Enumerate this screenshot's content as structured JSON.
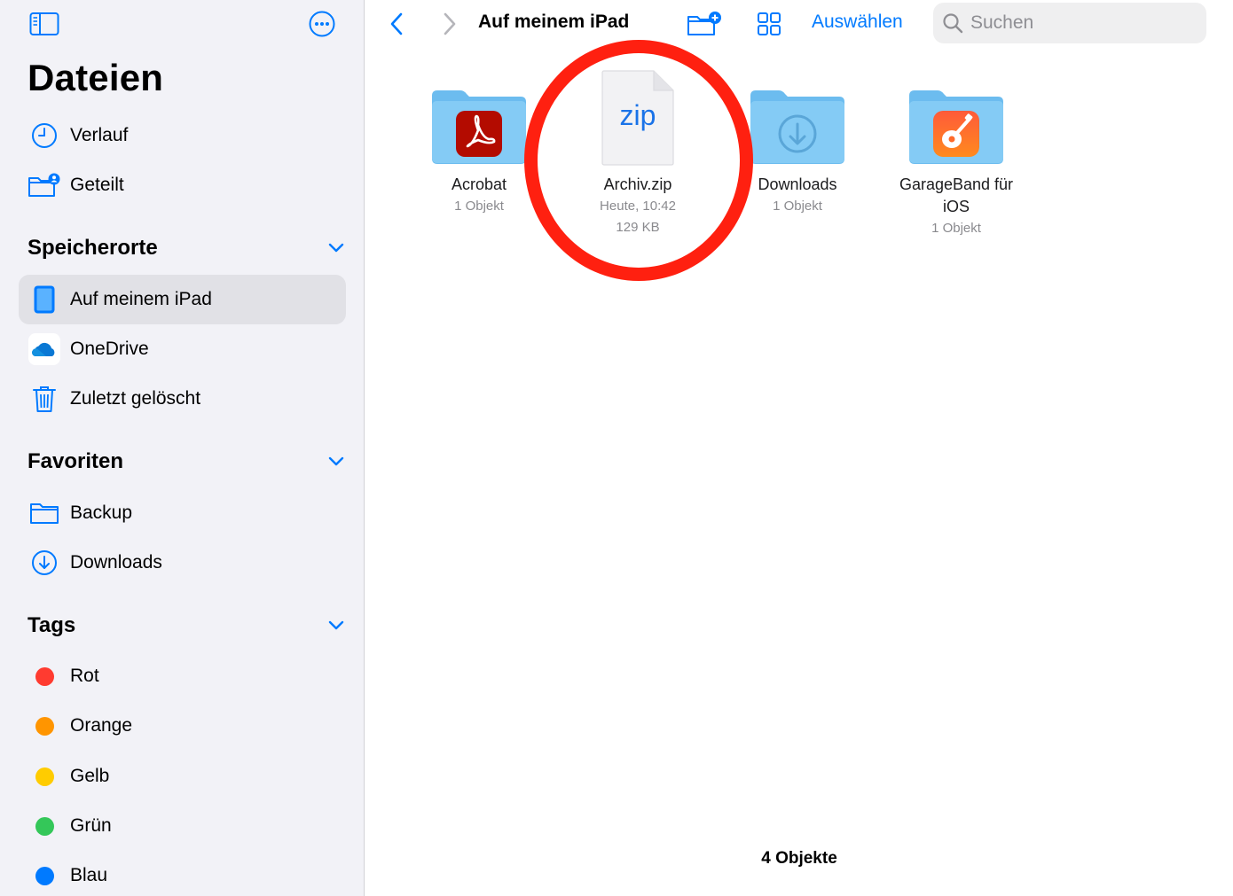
{
  "sidebar": {
    "title": "Dateien",
    "recents": [
      {
        "label": "Verlauf",
        "icon": "clock-icon"
      },
      {
        "label": "Geteilt",
        "icon": "shared-folder-icon"
      }
    ],
    "locations": {
      "header": "Speicherorte",
      "items": [
        {
          "label": "Auf meinem iPad",
          "icon": "ipad-icon",
          "selected": true
        },
        {
          "label": "OneDrive",
          "icon": "onedrive-icon"
        },
        {
          "label": "Zuletzt gelöscht",
          "icon": "trash-icon"
        }
      ]
    },
    "favorites": {
      "header": "Favoriten",
      "items": [
        {
          "label": "Backup",
          "icon": "folder-icon"
        },
        {
          "label": "Downloads",
          "icon": "download-circle-icon"
        }
      ]
    },
    "tags": {
      "header": "Tags",
      "items": [
        {
          "label": "Rot",
          "color": "#ff3b30"
        },
        {
          "label": "Orange",
          "color": "#ff9500"
        },
        {
          "label": "Gelb",
          "color": "#ffcc00"
        },
        {
          "label": "Grün",
          "color": "#34c759"
        },
        {
          "label": "Blau",
          "color": "#007aff"
        }
      ]
    }
  },
  "toolbar": {
    "title": "Auf meinem iPad",
    "select_label": "Auswählen",
    "search_placeholder": "Suchen"
  },
  "files": [
    {
      "name": "Acrobat",
      "meta": [
        "1 Objekt"
      ],
      "icon": "acrobat-folder-icon"
    },
    {
      "name": "Archiv.zip",
      "meta": [
        "Heute, 10:42",
        "129 KB"
      ],
      "icon": "zip-file-icon",
      "badge": "zip"
    },
    {
      "name": "Downloads",
      "meta": [
        "1 Objekt"
      ],
      "icon": "downloads-folder-icon"
    },
    {
      "name": "GarageBand für iOS",
      "meta": [
        "1 Objekt"
      ],
      "icon": "garageband-folder-icon"
    }
  ],
  "footer": {
    "count": "4 Objekte"
  },
  "colors": {
    "accent": "#007aff",
    "folder": "#7cc6f4",
    "highlight_ring": "#ff2010"
  }
}
